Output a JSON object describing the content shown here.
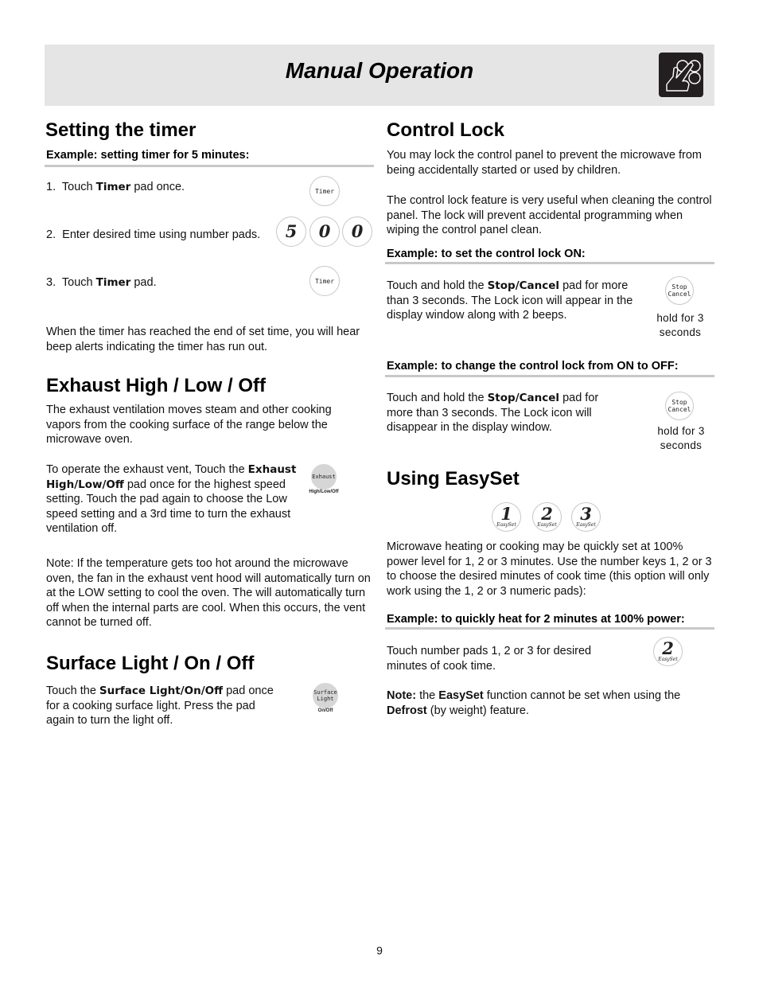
{
  "header": {
    "title": "Manual Operation",
    "icon": "hand-touching-keypad-icon"
  },
  "timer": {
    "heading": "Setting the timer",
    "example": "Example: setting timer for 5 minutes:",
    "steps": [
      {
        "num": "1.",
        "pre": "Touch ",
        "key": "Timer",
        "post": " pad once."
      },
      {
        "num": "2.",
        "text": "Enter desired time using number pads."
      },
      {
        "num": "3.",
        "pre": "Touch ",
        "key": "Timer",
        "post": " pad."
      }
    ],
    "timer_pad_label": "Timer",
    "number_pads": [
      "5",
      "0",
      "0"
    ],
    "note": "When the timer has reached the end of set time, you will hear beep alerts indicating the timer has run out."
  },
  "exhaust": {
    "heading": "Exhaust High / Low / Off",
    "intro": "The exhaust ventilation moves steam and other cooking vapors from the cooking surface of the range below the microwave oven.",
    "operate_pre": "To operate the exhaust vent, Touch the ",
    "operate_key": "Exhaust High/Low/Off",
    "operate_post": " pad once for the highest speed setting. Touch the pad again to choose the Low speed setting and a 3rd time to turn the exhaust ventilation off.",
    "pad_label": "Exhaust",
    "pad_caption": "High/Low/Off",
    "note": "Note: If the temperature gets too hot around the microwave oven, the fan in the exhaust vent hood will automatically turn on at the LOW setting to cool the oven. The will automatically turn off when the internal parts are cool. When this occurs, the vent cannot be turned off."
  },
  "surface_light": {
    "heading": "Surface Light / On / Off",
    "pre": "Touch the ",
    "key": "Surface Light/On/Off",
    "post": " pad once for a cooking surface light. Press the pad again to turn the light off.",
    "pad_label_1": "Surface",
    "pad_label_2": "Light",
    "pad_caption": "On/Off"
  },
  "control_lock": {
    "heading": "Control Lock",
    "intro1": "You may lock the control panel to prevent the microwave from being accidentally started or used by children.",
    "intro2": "The control lock feature is very useful when cleaning the control panel. The lock will prevent accidental programming when wiping the control panel clean.",
    "example_on": "Example: to set the control lock ON:",
    "on_pre": "Touch and hold the ",
    "on_key": "Stop/Cancel",
    "on_post": " pad for more than 3 seconds. The Lock icon will appear in the display window along with 2 beeps.",
    "example_off": "Example: to change the control lock from ON to OFF:",
    "off_pre": "Touch and hold the ",
    "off_key": "Stop/Cancel",
    "off_post": " pad for more than 3 seconds. The Lock icon will disappear in the display window.",
    "pad_label_1": "Stop",
    "pad_label_2": "Cancel",
    "hold_1": "hold for 3",
    "hold_2": "seconds"
  },
  "easyset": {
    "heading": "Using EasySet",
    "pads": [
      {
        "num": "1",
        "sub": "EasySet"
      },
      {
        "num": "2",
        "sub": "EasySet"
      },
      {
        "num": "3",
        "sub": "EasySet"
      }
    ],
    "description": "Microwave heating or cooking may be quickly set at 100% power level for 1, 2 or 3 minutes. Use the number keys  1, 2 or 3 to choose the desired minutes of cook time (this option will only work using the 1, 2 or 3 numeric pads):",
    "example": "Example: to quickly heat for 2 minutes at 100% power:",
    "instruction": "Touch number pads 1, 2 or 3 for desired minutes of cook time.",
    "example_pad": {
      "num": "2",
      "sub": "EasySet"
    },
    "note_label": "Note:",
    "note_pre": " the ",
    "note_key": "EasySet",
    "note_mid": " function cannot be set when using the ",
    "note_key2": "Defrost",
    "note_post": "  (by weight) feature."
  },
  "page_number": "9"
}
